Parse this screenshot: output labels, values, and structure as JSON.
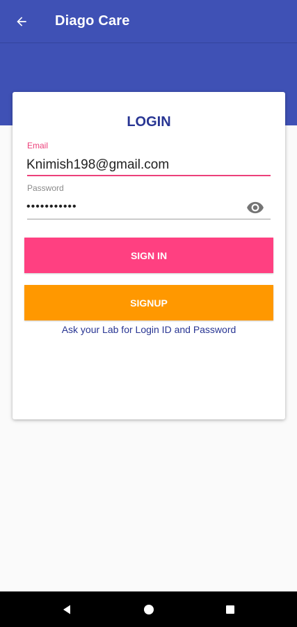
{
  "app": {
    "title": "Diago Care",
    "colors": {
      "primary": "#3f51b5",
      "accent": "#ff4081",
      "signup": "#ff9800",
      "title_text": "#283593"
    }
  },
  "appbar": {
    "back_icon": "arrow-back-icon"
  },
  "login_card": {
    "title": "LOGIN",
    "email": {
      "label": "Email",
      "value": "Knimish198@gmail.com"
    },
    "password": {
      "label": "Password",
      "value": "•••••••••••",
      "toggle_icon": "eye-icon"
    },
    "signin_label": "SIGN IN",
    "signup_label": "SIGNUP",
    "help_text": "Ask your Lab for Login ID and Password"
  },
  "navbar": {
    "back_icon": "triangle-back-icon",
    "home_icon": "circle-home-icon",
    "recents_icon": "square-recents-icon"
  }
}
